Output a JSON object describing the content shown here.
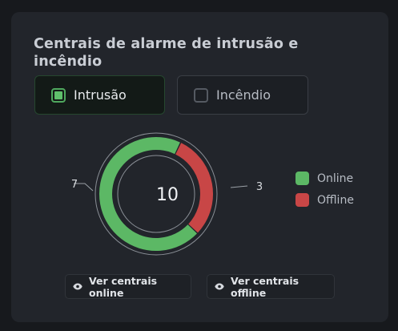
{
  "card": {
    "title": "Centrais de alarme de intrusão e incêndio"
  },
  "filters": {
    "intrusion_label": "Intrusão",
    "fire_label": "Incêndio"
  },
  "chart_data": {
    "type": "pie",
    "total": "10",
    "categories": [
      "Online",
      "Offline"
    ],
    "values": [
      7,
      3
    ],
    "colors": [
      "#5cb865",
      "#c84646"
    ]
  },
  "legend": {
    "online_label": "Online",
    "offline_label": "Offline"
  },
  "actions": {
    "view_online_label": "Ver centrais online",
    "view_offline_label": "Ver centrais offline"
  }
}
